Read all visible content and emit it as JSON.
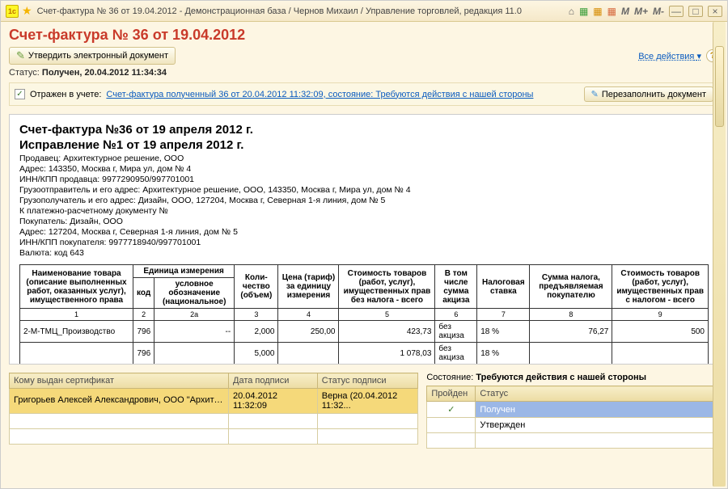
{
  "window": {
    "title": "Счет-фактура № 36 от 19.04.2012 - Демонстрационная база / Чернов Михаил / Управление торговлей, редакция 11.0"
  },
  "toolbar_icons": {
    "m1": "M",
    "m2": "M+",
    "m3": "M-"
  },
  "header": {
    "title": "Счет-фактура № 36 от 19.04.2012",
    "approve_label": "Утвердить электронный документ",
    "all_actions": "Все действия",
    "status_label": "Статус:",
    "status_value": "Получен, 20.04.2012 11:34:34",
    "reflect_label": "Отражен в учете:",
    "reflect_link": "Счет-фактура полученный 36 от 20.04.2012 11:32:09, состояние: Требуются действия с нашей стороны",
    "refill_label": "Перезаполнить документ"
  },
  "paper": {
    "h1": "Счет-фактура №36 от 19 апреля 2012 г.",
    "h2": "Исправление №1 от 19 апреля 2012 г.",
    "lines": {
      "l0": "Продавец: Архитектурное решение, ООО",
      "l1": "Адрес: 143350, Москва г, Мира ул, дом № 4",
      "l2": "ИНН/КПП продавца: 9977290950/997701001",
      "l3": "Грузоотправитель и его адрес: Архитектурное решение, ООО, 143350, Москва г, Мира ул, дом № 4",
      "l4": "Грузополучатель и его адрес: Дизайн, ООО, 127204, Москва г, Северная 1-я линия, дом № 5",
      "l5": "К платежно-расчетному документу №",
      "l6": "Покупатель: Дизайн, ООО",
      "l7": "Адрес: 127204, Москва г, Северная 1-я линия, дом № 5",
      "l8": "ИНН/КПП покупателя: 9977718940/997701001",
      "l9": "Валюта: код 643"
    },
    "table": {
      "head": {
        "c1": "Наименование товара (описание выполненных работ, оказанных услуг), имущественного права",
        "c2": "Единица измерения",
        "c2a": "код",
        "c2b": "условное обозначение (национальное)",
        "c3": "Коли-чество (объем)",
        "c4": "Цена (тариф) за единицу измерения",
        "c5": "Стоимость товаров (работ, услуг), имущественных прав без налога - всего",
        "c6": "В том числе сумма акциза",
        "c7": "Налоговая ставка",
        "c8": "Сумма налога, предъявляемая покупателю",
        "c9": "Стоимость товаров (работ, услуг), имущественных прав с налогом - всего"
      },
      "numrow": {
        "n1": "1",
        "n2": "2",
        "n2a": "2а",
        "n3": "3",
        "n4": "4",
        "n5": "5",
        "n6": "6",
        "n7": "7",
        "n8": "8",
        "n9": "9"
      },
      "rows": [
        {
          "name": "2-М-ТМЦ_Производство",
          "code": "796",
          "unit": "--",
          "qty": "2,000",
          "price": "250,00",
          "sum_nt": "423,73",
          "excise": "без акциза",
          "rate": "18 %",
          "tax": "76,27",
          "sum_t": "500"
        },
        {
          "name": "",
          "code": "796",
          "unit": "",
          "qty": "5,000",
          "price": "",
          "sum_nt": "1 078,03",
          "excise": "без акциза",
          "rate": "18 %",
          "tax": "",
          "sum_t": ""
        }
      ]
    }
  },
  "cert_table": {
    "h1": "Кому выдан сертификат",
    "h2": "Дата подписи",
    "h3": "Статус подписи",
    "row": {
      "who": "Григорьев Алексей Александрович, ООО \"Архитектурное решен...",
      "date": "20.04.2012 11:32:09",
      "status": "Верна (20.04.2012 11:32..."
    }
  },
  "state_panel": {
    "label": "Состояние:",
    "value": "Требуются действия с нашей стороны",
    "h1": "Пройден",
    "h2": "Статус",
    "rows": [
      {
        "check": "✓",
        "status": "Получен",
        "hi": true
      },
      {
        "check": "",
        "status": "Утвержден",
        "hi": false
      }
    ]
  }
}
